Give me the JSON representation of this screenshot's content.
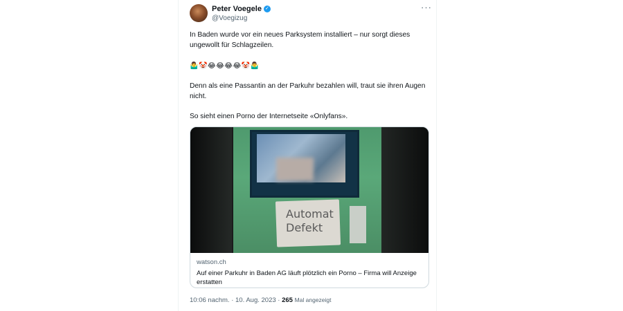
{
  "tweet": {
    "author_name": "Peter Voegele",
    "author_handle": "@Voegizug",
    "verified_icon": "✓",
    "more_icon": "···",
    "paragraph1": "In Baden wurde vor ein neues Parksystem installiert – nur sorgt dieses ungewollt für Schlagzeilen.",
    "emoji_line": "🤷‍♂️🤡😂😂😂😂🤡🤷‍♂️",
    "paragraph2": "Denn als eine Passantin an der Parkuhr bezahlen will, traut sie ihren Augen nicht.",
    "paragraph3": "So sieht einen Porno der Internetseite «Onlyfans».",
    "card": {
      "image_sign_text": "Automat Defekt",
      "domain": "watson.ch",
      "headline": "Auf einer Parkuhr in Baden AG läuft plötzlich ein Porno – Firma will Anzeige erstatten"
    },
    "meta": {
      "timestamp": "10:06 nachm. · 10. Aug. 2023 ·",
      "views_count": "265",
      "views_label": "Mal angezeigt"
    }
  },
  "colors": {
    "verified_blue": "#1d9bf0",
    "secondary_text": "#536471",
    "border": "#cfd9de"
  }
}
